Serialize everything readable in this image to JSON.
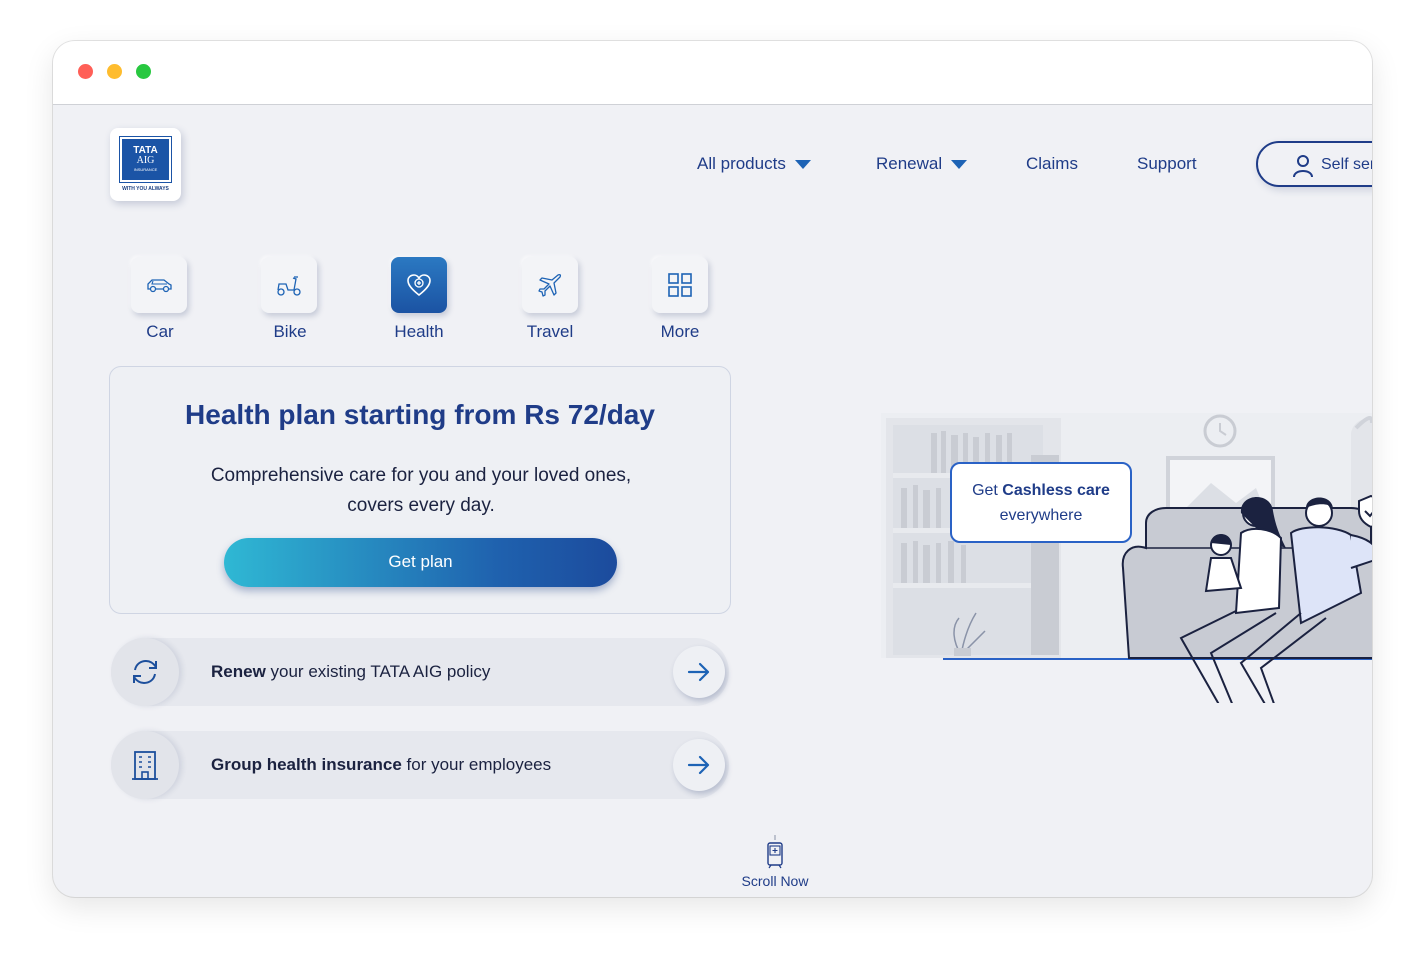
{
  "brand": {
    "logo_line1": "TATA",
    "logo_line2": "AIG",
    "logo_line3": "INSURANCE",
    "tagline": "WITH YOU ALWAYS"
  },
  "nav": {
    "all_products": "All products",
    "renewal": "Renewal",
    "claims": "Claims",
    "support": "Support",
    "self_service": "Self ser"
  },
  "products": [
    {
      "label": "Car",
      "icon": "car-icon",
      "active": false
    },
    {
      "label": "Bike",
      "icon": "scooter-icon",
      "active": false
    },
    {
      "label": "Health",
      "icon": "heart-icon",
      "active": true
    },
    {
      "label": "Travel",
      "icon": "plane-icon",
      "active": false
    },
    {
      "label": "More",
      "icon": "grid-icon",
      "active": false
    }
  ],
  "hero": {
    "title": "Health plan starting from Rs 72/day",
    "subtitle": "Comprehensive care for you and your loved ones, covers every day.",
    "cta": "Get plan"
  },
  "rows": [
    {
      "bold": "Renew",
      "rest": " your existing TATA AIG policy",
      "icon": "refresh-icon"
    },
    {
      "bold": "Group health insurance",
      "rest": " for your employees",
      "icon": "building-icon"
    }
  ],
  "bubble": {
    "prefix": "Get ",
    "bold": "Cashless care",
    "line2": "everywhere"
  },
  "scroll_label": "Scroll Now",
  "colors": {
    "primary": "#1f3c88",
    "accent": "#1d63b5",
    "gradient_start": "#2fb8d4",
    "gradient_end": "#1c4b9d",
    "background": "#f0f1f5"
  }
}
